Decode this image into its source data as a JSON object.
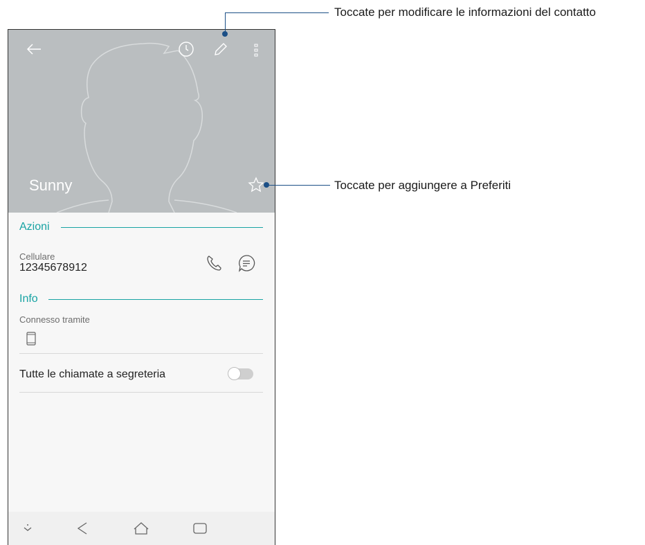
{
  "contact": {
    "name": "Sunny"
  },
  "header_icons": {
    "back": "back-arrow-icon",
    "history": "clock-icon",
    "edit": "pencil-icon",
    "more": "more-vertical-icon",
    "favorite": "star-outline-icon"
  },
  "actions": {
    "title": "Azioni",
    "phone_label": "Cellulare",
    "phone_number": "12345678912",
    "call_icon": "phone-icon",
    "message_icon": "message-bubble-icon"
  },
  "info": {
    "title": "Info",
    "connected_label": "Connesso tramite",
    "device_icon": "phone-device-icon",
    "voicemail_label": "Tutte le chiamate a segreteria",
    "voicemail_enabled": false
  },
  "navbar": {
    "icons": [
      "hide-bar-icon",
      "back-triangle-icon",
      "home-icon",
      "recents-icon"
    ]
  },
  "callouts": {
    "edit": "Toccate per modificare le informazioni del contatto",
    "favorite": "Toccate per aggiungere a Preferiti"
  },
  "colors": {
    "header": "#babec0",
    "accent": "#17a3a3",
    "callout_line": "#1b4f86"
  }
}
